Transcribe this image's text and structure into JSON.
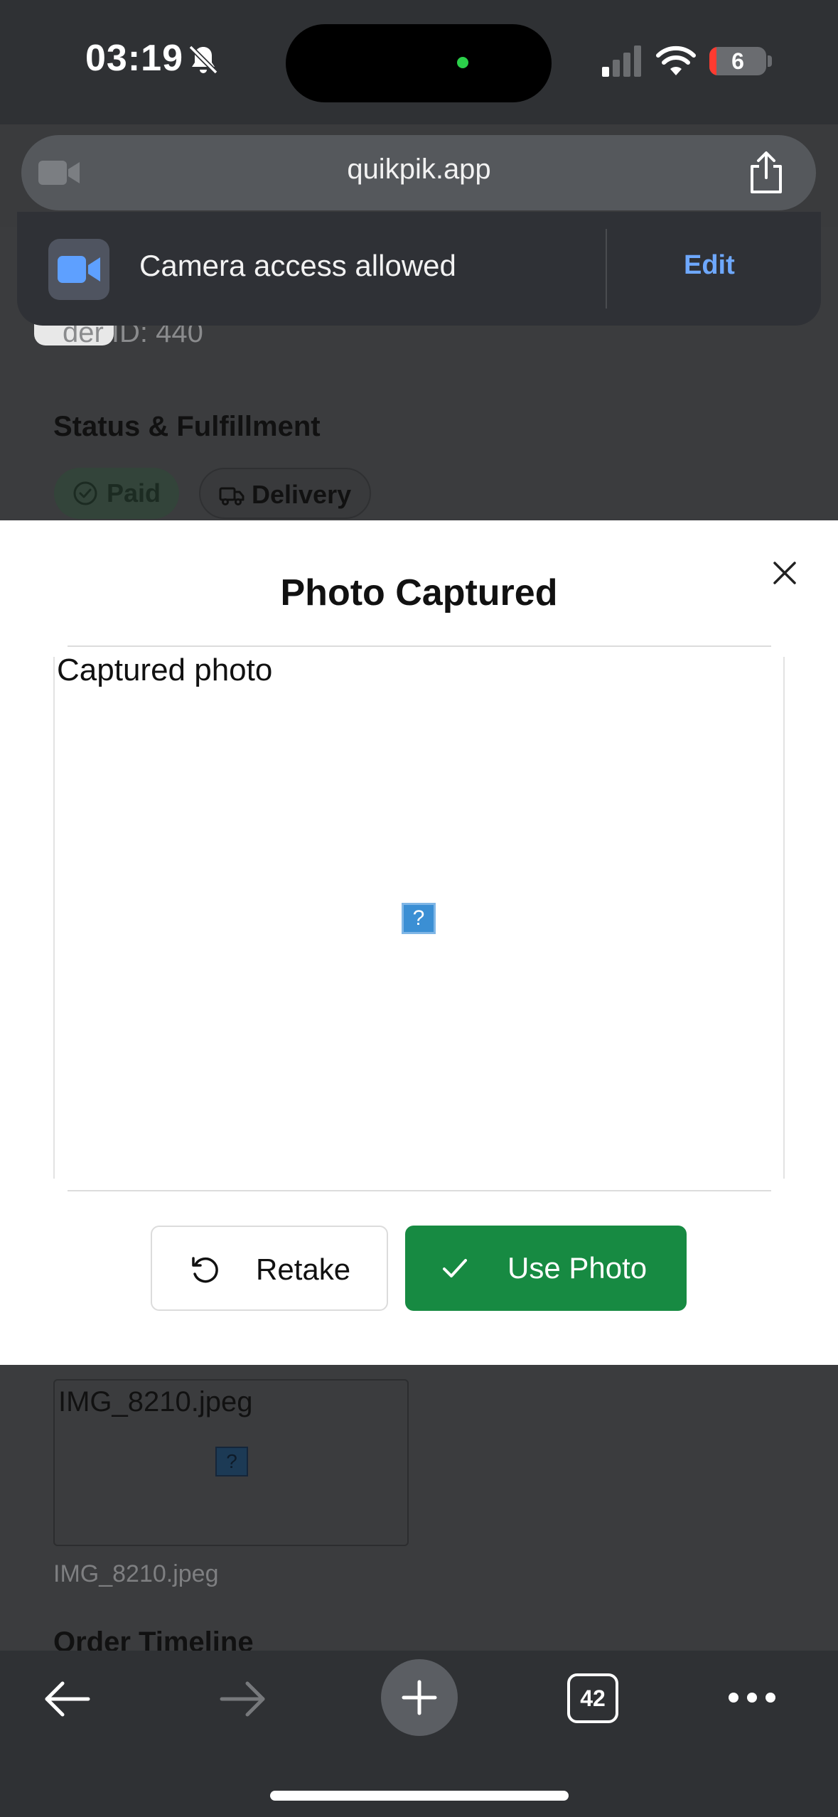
{
  "status_bar": {
    "time": "03:19",
    "battery": "6"
  },
  "browser": {
    "url": "quikpik.app",
    "tab_count": "42"
  },
  "notification": {
    "text": "Camera access allowed",
    "edit_label": "Edit"
  },
  "background_page": {
    "order_id": "der ID: 440",
    "status_heading": "Status & Fulfillment",
    "chips": [
      "Paid",
      "Delivery"
    ],
    "attachment_alt": "IMG_8210.jpeg",
    "attachment_name": "IMG_8210.jpeg",
    "timeline_heading": "Order Timeline",
    "missing_image_glyph": "?"
  },
  "modal": {
    "title": "Photo Captured",
    "photo_alt": "Captured photo",
    "missing_image_glyph": "?",
    "retake_label": "Retake",
    "use_label": "Use Photo"
  },
  "colors": {
    "accent_green": "#178a42",
    "edit_link": "#6ea8ff",
    "battery_low": "#ff3b30"
  },
  "icons": [
    "bell-slash-icon",
    "signal-icon",
    "wifi-icon",
    "video-camera-icon",
    "share-icon",
    "check-circle-icon",
    "truck-icon",
    "close-icon",
    "rotate-ccw-icon",
    "check-icon",
    "arrow-left-icon",
    "arrow-right-icon",
    "plus-icon",
    "ellipsis-icon"
  ]
}
